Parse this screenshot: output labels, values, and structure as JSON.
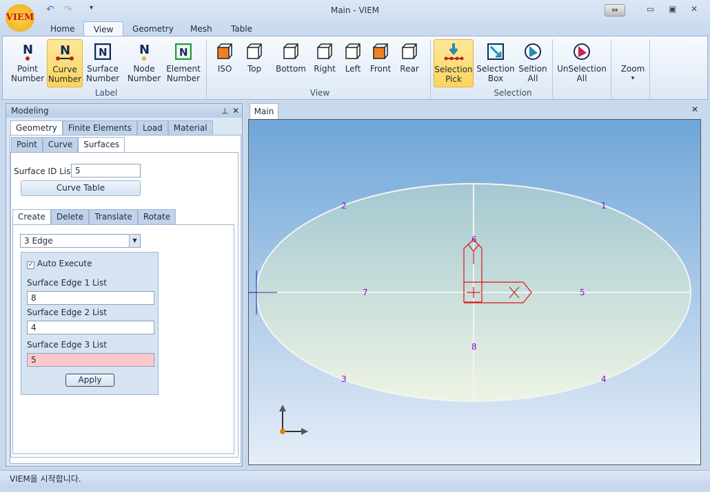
{
  "window": {
    "title": "Main - VIEM",
    "logo": "VIEM"
  },
  "quick_access": {
    "undo": "undo-icon",
    "redo": "redo-icon",
    "customize": "▾"
  },
  "ribbon_tabs": [
    "Home",
    "View",
    "Geometry",
    "Mesh",
    "Table"
  ],
  "ribbon_active_tab": "View",
  "label_group": {
    "title": "Label",
    "buttons": [
      {
        "l1": "Point",
        "l2": "Number"
      },
      {
        "l1": "Curve",
        "l2": "Number",
        "selected": true
      },
      {
        "l1": "Surface",
        "l2": "Number"
      },
      {
        "l1": "Node",
        "l2": "Number"
      },
      {
        "l1": "Element",
        "l2": "Number"
      }
    ]
  },
  "view_group": {
    "title": "View",
    "buttons": [
      "ISO",
      "Top",
      "Bottom",
      "Right",
      "Left",
      "Front",
      "Rear"
    ]
  },
  "selection_group": {
    "title": "Selection",
    "buttons": [
      {
        "l1": "Selection",
        "l2": "Pick",
        "selected": true
      },
      {
        "l1": "Selection",
        "l2": "Box"
      },
      {
        "l1": "Seltion",
        "l2": "All"
      },
      {
        "l1": "UnSelection",
        "l2": "All"
      }
    ]
  },
  "zoom": {
    "label": "Zoom",
    "arrow": "▾"
  },
  "panel": {
    "title": "Modeling",
    "pin": "⊥",
    "close": "✕",
    "tabs": [
      "Geometry",
      "Finite Elements",
      "Load",
      "Material"
    ],
    "subtabs": [
      "Point",
      "Curve",
      "Surfaces"
    ],
    "surface_id_label": "Surface ID List",
    "surface_id_value": "5",
    "curve_table": "Curve Table",
    "op_tabs": [
      "Create",
      "Delete",
      "Translate",
      "Rotate"
    ],
    "method": "3 Edge",
    "auto_execute": "Auto Execute",
    "auto_checked": true,
    "edge1_label": "Surface Edge 1 List",
    "edge1": "8",
    "edge2_label": "Surface Edge 2 List",
    "edge2": "4",
    "edge3_label": "Surface Edge 3 List",
    "edge3": "5",
    "apply": "Apply"
  },
  "viewport": {
    "tab": "Main",
    "close": "✕",
    "curve_labels": [
      "1",
      "2",
      "3",
      "4",
      "5",
      "6",
      "7",
      "8"
    ]
  },
  "status": "VIEM을 시작합니다.",
  "colors": {
    "selected": "#fbd45c",
    "highlight_input": "#fcc8cc",
    "curve_label": "#8a10c0",
    "axis_red": "#e01010"
  }
}
